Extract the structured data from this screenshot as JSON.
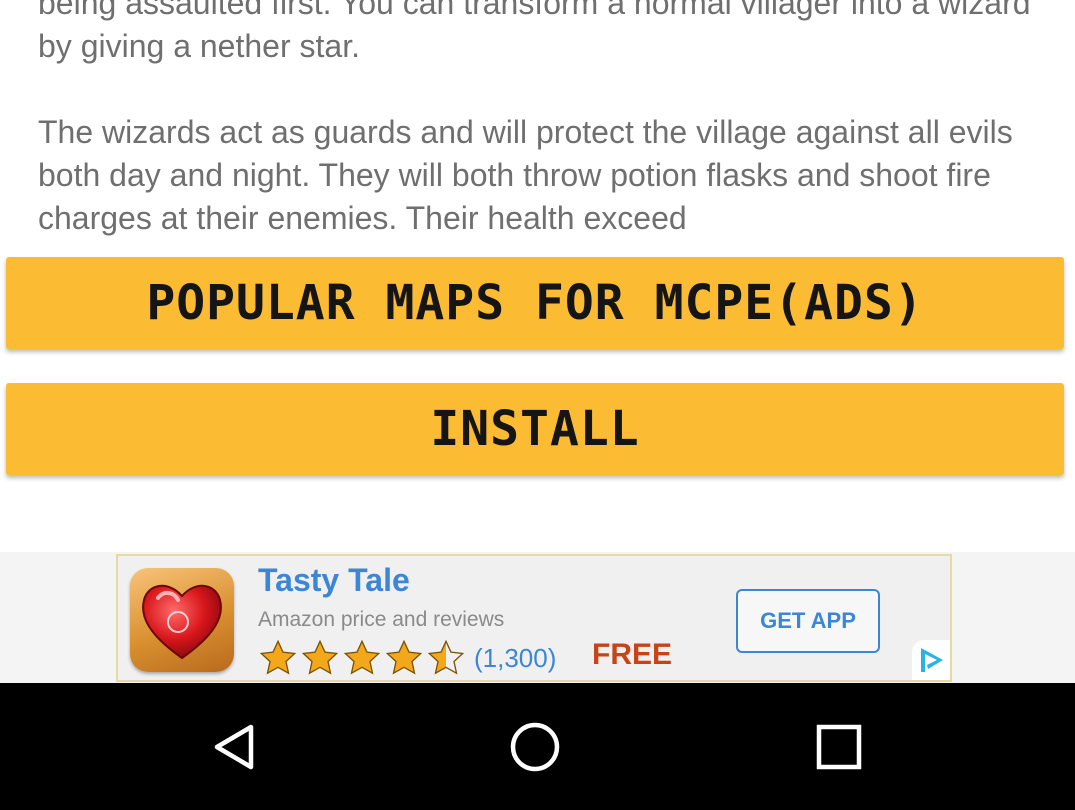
{
  "description": {
    "paragraph1": "being assaulted first. You can transform a normal villager into a wizard by giving a nether star.",
    "paragraph2": "The wizards act as guards and will protect the village against all evils both day and night. They will both throw potion flasks and shoot fire charges at their enemies. Their health exceed"
  },
  "buttons": {
    "popular_maps": "POPULAR MAPS FOR MCPE(ADS)",
    "install": "INSTALL"
  },
  "ad": {
    "app_name": "Tasty Tale",
    "subtitle": "Amazon price and reviews",
    "rating_stars": 4.5,
    "rating_count": "(1,300)",
    "price": "FREE",
    "cta": "GET APP",
    "icon": "heart-chocolate-box-icon",
    "adchoices_icon": "adchoices-icon"
  },
  "navbar": {
    "back_icon": "back-triangle-icon",
    "home_icon": "home-circle-icon",
    "recents_icon": "recents-square-icon"
  },
  "colors": {
    "button_yellow": "#fbbb33",
    "ad_blue": "#3b86d6",
    "free_red": "#c9431a",
    "star_gold": "#f3a81b"
  }
}
